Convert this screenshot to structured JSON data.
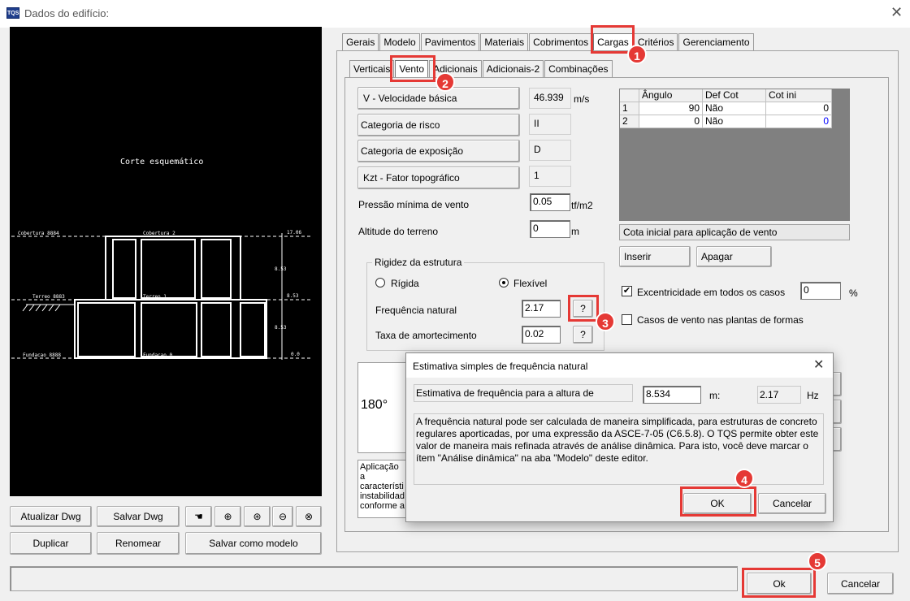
{
  "window": {
    "title": "Dados do edifício:",
    "app_icon_text": "TQS",
    "close_glyph": "✕"
  },
  "main_tabs": [
    "Gerais",
    "Modelo",
    "Pavimentos",
    "Materiais",
    "Cobrimentos",
    "Cargas",
    "Critérios",
    "Gerenciamento"
  ],
  "sub_tabs": [
    "Verticais",
    "Vento",
    "Adicionais",
    "Adicionais-2",
    "Combinações"
  ],
  "drawing": {
    "title": "Corte esquemático",
    "labels": [
      "Cobertura 8884",
      "Cobertura 2",
      "17.06",
      "8.53",
      "Terreo 8883",
      "Terreo 1",
      "8.53",
      "8.53",
      "Fundacao 8888",
      "Fundacao 0",
      "0.0"
    ]
  },
  "wind": {
    "v_button": "V - Velocidade básica",
    "v_value": "46.939",
    "v_unit": "m/s",
    "risk_button": "Categoria de risco",
    "risk_value": "II",
    "exposure_button": "Categoria de exposição",
    "exposure_value": "D",
    "kzt_button": "Kzt - Fator topográfico",
    "kzt_value": "1",
    "min_pressure_label": "Pressão mínima de vento",
    "min_pressure_value": "0.05",
    "min_pressure_unit": "tf/m2",
    "altitude_label": "Altitude do terreno",
    "altitude_value": "0",
    "altitude_unit": "m",
    "rigidity_group": "Rigidez da estrutura",
    "rigid_label": "Rígida",
    "flexible_label": "Flexível",
    "freq_label": "Frequência natural",
    "freq_value": "2.17",
    "damping_label": "Taxa de amortecimento",
    "damping_value": "0.02",
    "help_glyph": "?",
    "angle_glyph": "180°",
    "description": "Aplicação a característi instabilidad conforme a"
  },
  "grid": {
    "headers": [
      "",
      "Ângulo",
      "Def Cot",
      "Cot ini"
    ],
    "rows": [
      [
        "1",
        "90",
        "Não",
        "0"
      ],
      [
        "2",
        "0",
        "Não",
        "0"
      ]
    ],
    "caption": "Cota inicial para aplicação de vento",
    "insert_button": "Inserir",
    "delete_button": "Apagar"
  },
  "options": {
    "eccentricity_label": "Excentricidade em todos os casos",
    "eccentricity_value": "0",
    "eccentricity_unit": "%",
    "eccentricity_checked": true,
    "forms_label": "Casos de vento nas plantas de formas",
    "forms_checked": false
  },
  "dialog": {
    "title": "Estimativa simples de frequência natural",
    "row_label": "Estimativa de frequência para a altura de",
    "height_value": "8.534",
    "height_unit": "m:",
    "freq_value": "2.17",
    "freq_unit": "Hz",
    "text": "A frequência natural pode ser calculada de maneira simplificada, para estruturas de concreto regulares aporticadas, por uma expressão da ASCE-7-05 (C6.5.8). O TQS permite obter este valor de maneira mais refinada através de análise dinâmica. Para isto, você deve marcar o ítem \"Análise dinâmica\" na aba \"Modelo\" deste editor.",
    "ok": "OK",
    "cancel": "Cancelar"
  },
  "left_buttons": {
    "update": "Atualizar Dwg",
    "save": "Salvar Dwg",
    "duplicate": "Duplicar",
    "rename": "Renomear",
    "save_model": "Salvar como modelo"
  },
  "footer": {
    "ok": "Ok",
    "cancel": "Cancelar"
  },
  "steps": [
    "1",
    "2",
    "3",
    "4",
    "5"
  ],
  "colors": {
    "marker": "#e53935",
    "drawing_bg": "#000000",
    "grid_bg": "#808080"
  }
}
